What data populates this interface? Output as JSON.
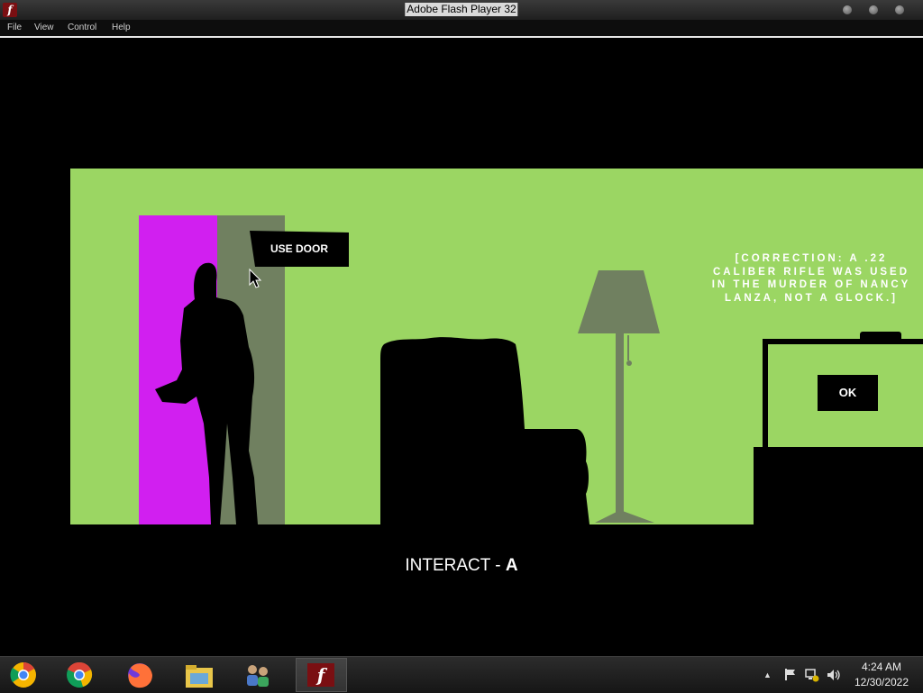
{
  "window": {
    "title": "Adobe Flash Player 32",
    "app_icon": "f",
    "controls": [
      "minimize-icon",
      "maximize-icon",
      "close-icon"
    ]
  },
  "menu": {
    "items": [
      {
        "label": "File"
      },
      {
        "label": "View"
      },
      {
        "label": "Control"
      },
      {
        "label": "Help"
      }
    ]
  },
  "game": {
    "colors": {
      "wall": "#9bd663",
      "door_magenta": "#d11ff0",
      "door_gray": "#708060",
      "lamp": "#708060"
    },
    "use_door_label": "USE DOOR",
    "correction_text": "[CORRECTION: A .22 CALIBER RIFLE WAS USED IN THE MURDER OF NANCY LANZA, NOT A GLOCK.]",
    "ok_label": "OK",
    "interact_prefix": "INTERACT - ",
    "interact_key": "A"
  },
  "taskbar": {
    "apps": [
      {
        "name": "chrome-canary-icon"
      },
      {
        "name": "chrome-icon"
      },
      {
        "name": "firefox-icon"
      },
      {
        "name": "file-explorer-icon"
      },
      {
        "name": "network-users-icon"
      },
      {
        "name": "flash-player-icon",
        "label": "f"
      }
    ],
    "tray": {
      "up_arrow": "▲",
      "icons": [
        "show-hidden-icons-icon",
        "action-center-flag-icon",
        "network-icon",
        "volume-icon"
      ]
    },
    "clock": {
      "time": "4:24 AM",
      "date": "12/30/2022"
    }
  }
}
